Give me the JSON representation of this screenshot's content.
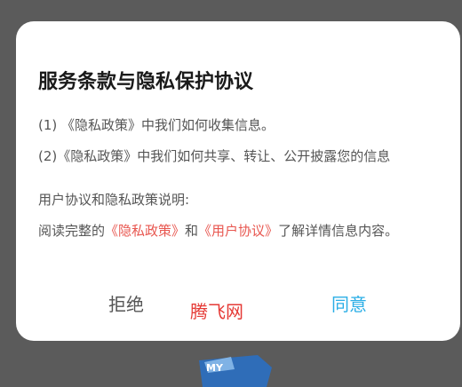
{
  "dialog": {
    "title": "服务条款与隐私保护协议",
    "line1": "(1) 《隐私政策》中我们如何收集信息。",
    "line2": "(2)《隐私政策》中我们如何共享、转让、公开披露您的信息",
    "line3": "用户协议和隐私政策说明:",
    "line4": {
      "prefix": "阅读完整的",
      "privacy_link": "《隐私政策》",
      "and": "和",
      "user_link": "《用户协议》",
      "suffix": "了解详情信息内容。"
    },
    "reject_label": "拒绝",
    "agree_label": "同意"
  },
  "watermark": "腾飞网",
  "background_logo_text": "MY",
  "colors": {
    "link": "#e8564f",
    "agree": "#2aaee6",
    "watermark": "#e53935"
  }
}
